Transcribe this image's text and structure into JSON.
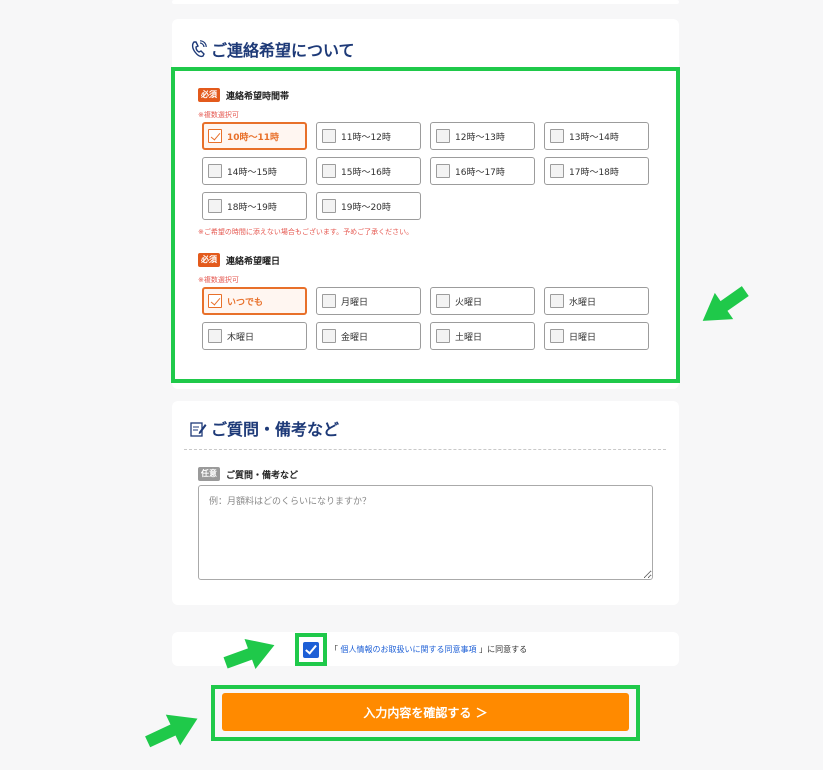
{
  "contact_section": {
    "title": "ご連絡希望について",
    "time_field": {
      "required_badge": "必須",
      "label": "連絡希望時間帯",
      "multi_note": "※複数選択可",
      "options": [
        {
          "label": "10時～11時",
          "checked": true
        },
        {
          "label": "11時～12時",
          "checked": false
        },
        {
          "label": "12時～13時",
          "checked": false
        },
        {
          "label": "13時～14時",
          "checked": false
        },
        {
          "label": "14時～15時",
          "checked": false
        },
        {
          "label": "15時～16時",
          "checked": false
        },
        {
          "label": "16時～17時",
          "checked": false
        },
        {
          "label": "17時～18時",
          "checked": false
        },
        {
          "label": "18時～19時",
          "checked": false
        },
        {
          "label": "19時～20時",
          "checked": false
        }
      ],
      "warning": "※ご希望の時間に添えない場合もございます。予めご了承ください。"
    },
    "day_field": {
      "required_badge": "必須",
      "label": "連絡希望曜日",
      "multi_note": "※複数選択可",
      "options": [
        {
          "label": "いつでも",
          "checked": true
        },
        {
          "label": "月曜日",
          "checked": false
        },
        {
          "label": "火曜日",
          "checked": false
        },
        {
          "label": "水曜日",
          "checked": false
        },
        {
          "label": "木曜日",
          "checked": false
        },
        {
          "label": "金曜日",
          "checked": false
        },
        {
          "label": "土曜日",
          "checked": false
        },
        {
          "label": "日曜日",
          "checked": false
        }
      ]
    }
  },
  "question_section": {
    "title": "ご質問・備考など",
    "optional_badge": "任意",
    "label": "ご質問・備考など",
    "placeholder": "例：月額料はどのくらいになりますか？"
  },
  "agreement": {
    "checked": true,
    "open_bracket": "「",
    "link_text": "個人情報のお取扱いに関する同意事項",
    "close_text": "」に同意する"
  },
  "submit": {
    "label": "入力内容を確認する ＞"
  },
  "colors": {
    "highlight": "#1fc94a",
    "accent": "#e8702a",
    "button": "#ff8a00",
    "title": "#1e3a78",
    "link": "#1d5fd6"
  }
}
